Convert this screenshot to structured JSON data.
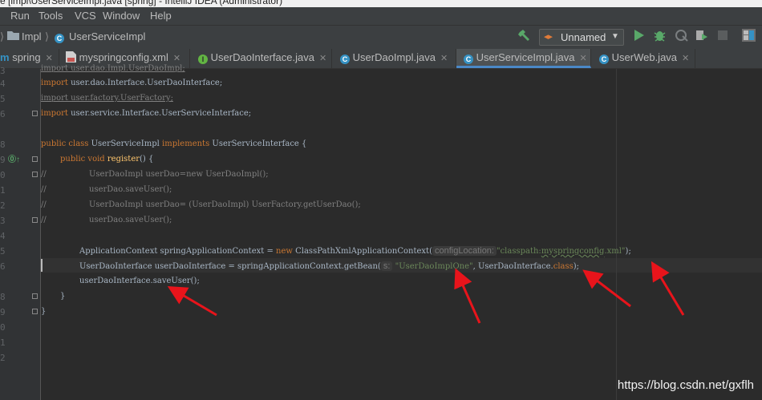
{
  "window": {
    "title": "e [impl\\UserServiceImpl.java [spring] - IntelliJ IDEA (Administrator)"
  },
  "menu": [
    "Run",
    "Tools",
    "VCS",
    "Window",
    "Help"
  ],
  "breadcrumb": [
    "Impl",
    "UserServiceImpl"
  ],
  "run_config": {
    "label": "Unnamed"
  },
  "tabs": [
    {
      "label": "spring",
      "active": false
    },
    {
      "label": "myspringconfig.xml",
      "active": false
    },
    {
      "label": "UserDaoInterface.java",
      "active": false
    },
    {
      "label": "UserDaoImpl.java",
      "active": false
    },
    {
      "label": "UserServiceImpl.java",
      "active": true
    },
    {
      "label": "UserWeb.java",
      "active": false
    }
  ],
  "line_numbers": [
    "3",
    "4",
    "5",
    "6",
    "",
    "8",
    "9",
    "0",
    "1",
    "2",
    "3",
    "4",
    "5",
    "6",
    "",
    "8",
    "9",
    "0",
    "1",
    "2"
  ],
  "code": {
    "l0": "import user.dao.Impl.UserDaoImpl;",
    "l1_kw": "import ",
    "l1": "user.dao.Interface.UserDaoInterface;",
    "l2": "import user.factory.UserFactory;",
    "l3_kw": "import ",
    "l3": "user.service.Interface.UserServiceInterface;",
    "l5_kw1": "public class ",
    "l5_name": "UserServiceImpl ",
    "l5_kw2": "implements ",
    "l5_rest": "UserServiceInterface {",
    "l6_kw": "public void ",
    "l6_fn": "register",
    "l6_rest": "() {",
    "c1_slash": "//",
    "c1": "UserDaoImpl userDao=new UserDaoImpl();",
    "c2_slash": "//",
    "c2": "userDao.saveUser();",
    "c3_slash": "//",
    "c3": "UserDaoImpl userDao= (UserDaoImpl) UserFactory.getUserDao();",
    "c4_slash": "//",
    "c4": "userDao.saveUser();",
    "l12_a": "ApplicationContext springApplicationContext = ",
    "l12_kw": "new ",
    "l12_b": "ClassPathXmlApplicationContext(",
    "l12_hint": "configLocation:",
    "l12_str1": "\"classpath:",
    "l12_str2": "myspringconfig",
    "l12_str3": ".xml\"",
    "l12_end": ");",
    "l13_a": "UserDaoInterface userDaoInterface = springApplicationContext.getBean(",
    "l13_hint": "s:",
    "l13_str": "\"UserDaoImplOne\"",
    "l13_b": ", UserDaoInterface.",
    "l13_kw": "class",
    "l13_end": ");",
    "l14": "userDaoInterface.saveUser();",
    "l15": "}",
    "l16": "}"
  },
  "watermark": "https://blog.csdn.net/gxflh",
  "colors": {
    "keyword": "#cc7832",
    "string": "#6a8759",
    "comment": "#808080",
    "annotation_arrows": "#e8141b"
  }
}
